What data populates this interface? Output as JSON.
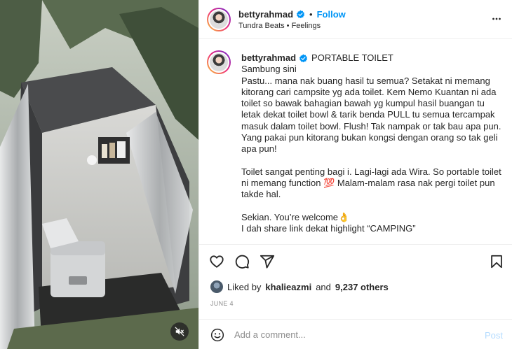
{
  "header": {
    "username": "bettyrahmad",
    "separator": "•",
    "follow_label": "Follow",
    "subtitle": "Tundra Beats • Feelings"
  },
  "caption": {
    "username": "bettyrahmad",
    "title": "PORTABLE TOILET",
    "lines": [
      "Sambung sini",
      "Pastu... mana nak buang hasil tu semua? Setakat ni memang",
      "kitorang cari campsite yg ada toilet. Kem Nemo Kuantan ni ada",
      "toilet so bawak bahagian bawah yg kumpul hasil buangan tu",
      "letak dekat toilet bowl & tarik benda PULL tu semua tercampak",
      "masuk dalam toilet bowl. Flush! Tak nampak or tak bau apa pun.",
      "Yang pakai pun kitorang bukan kongsi dengan orang so tak geli",
      "apa pun!",
      "",
      "Toilet sangat penting bagi i. Lagi-lagi ada Wira. So portable toilet",
      "ni memang function 💯 Malam-malam rasa nak pergi toilet pun",
      "takde hal.",
      "",
      "Sekian. You’re welcome👌",
      "I dah share link dekat highlight “CAMPING”"
    ]
  },
  "likes": {
    "prefix": "Liked by",
    "user": "khalieazmi",
    "middle": "and",
    "count": "9,237 others"
  },
  "date": "JUNE 4",
  "comment": {
    "placeholder": "Add a comment...",
    "post_label": "Post"
  },
  "colors": {
    "accent": "#0095f6",
    "post_disabled": "#b3dbff",
    "verified": "#0095f6",
    "muted_text": "#8e8e8e"
  },
  "icons": {
    "like": "heart-icon",
    "comment": "comment-icon",
    "share": "share-icon",
    "save": "bookmark-icon",
    "more": "more-icon",
    "emoji": "emoji-icon",
    "audio": "mute-icon",
    "verified": "verified-badge-icon"
  }
}
